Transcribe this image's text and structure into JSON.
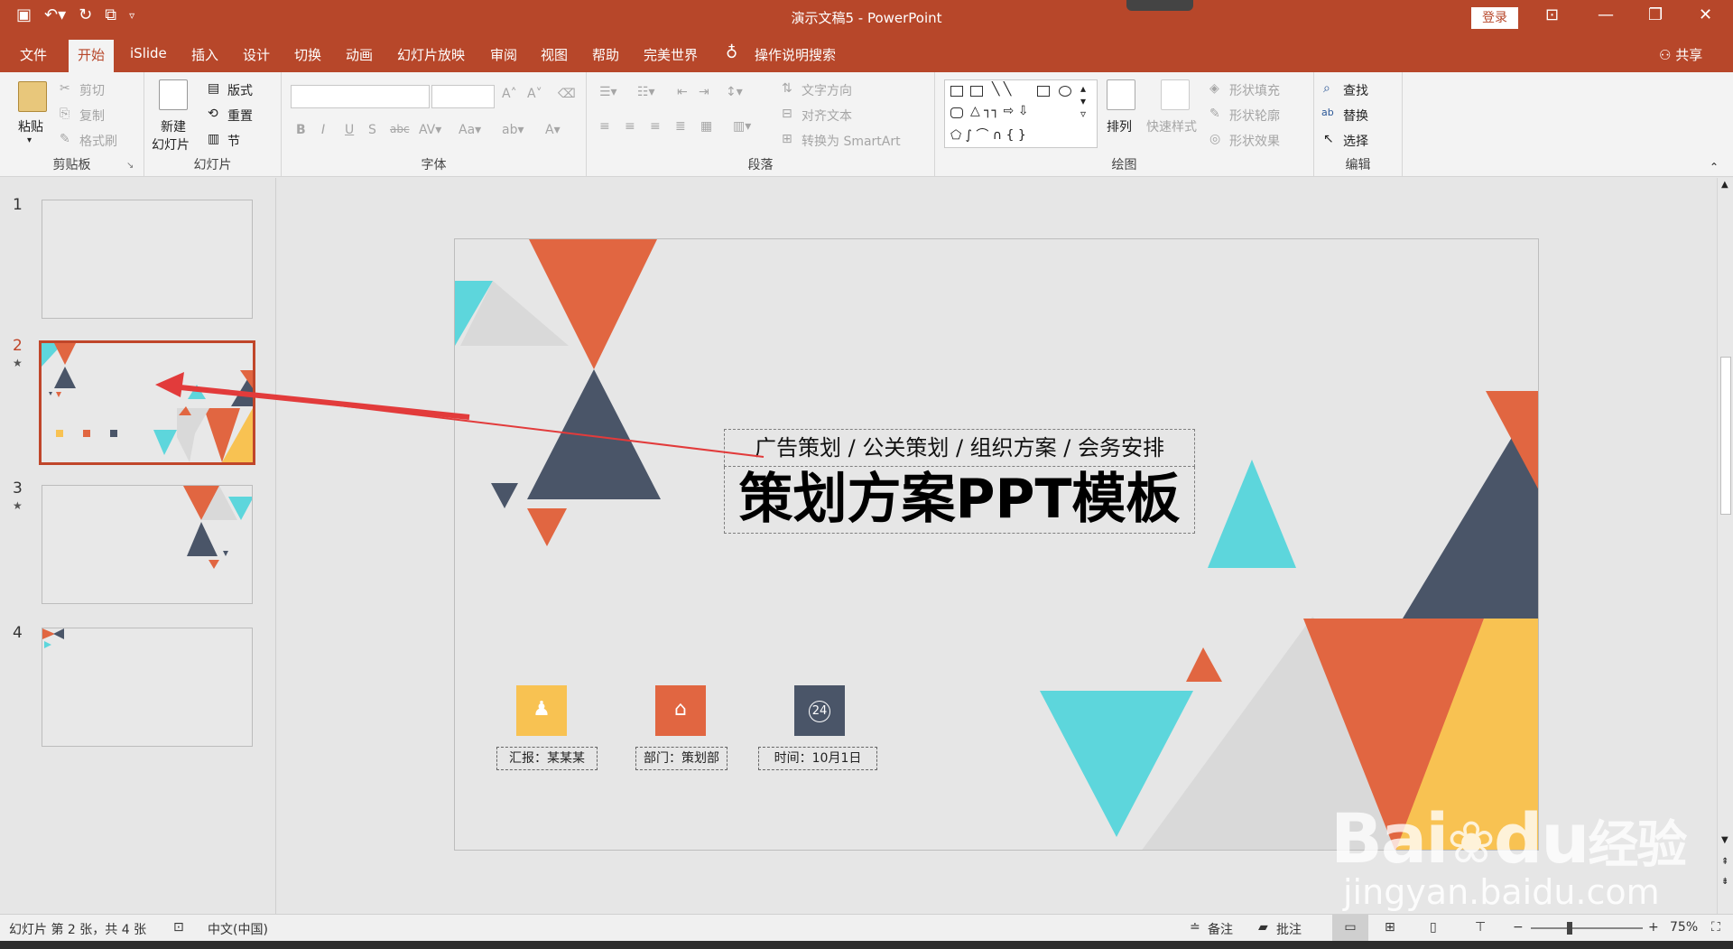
{
  "window": {
    "title": "演示文稿5 - PowerPoint",
    "login_label": "登录"
  },
  "tabs": {
    "items": [
      "文件",
      "开始",
      "iSlide",
      "插入",
      "设计",
      "切换",
      "动画",
      "幻灯片放映",
      "审阅",
      "视图",
      "帮助",
      "完美世界"
    ],
    "active": "开始",
    "tell_me": "操作说明搜索",
    "share": "共享"
  },
  "ribbon": {
    "clipboard": {
      "label": "剪贴板",
      "paste": "粘贴",
      "cut": "剪切",
      "copy": "复制",
      "format_painter": "格式刷"
    },
    "slides": {
      "label": "幻灯片",
      "new_slide_1": "新建",
      "new_slide_2": "幻灯片",
      "layout": "版式",
      "reset": "重置",
      "section": "节"
    },
    "font": {
      "label": "字体"
    },
    "paragraph": {
      "label": "段落",
      "text_direction": "文字方向",
      "align_text": "对齐文本",
      "smartart": "转换为 SmartArt"
    },
    "drawing": {
      "label": "绘图",
      "arrange": "排列",
      "quick_styles": "快速样式",
      "shape_fill": "形状填充",
      "shape_outline": "形状轮廓",
      "shape_effects": "形状效果"
    },
    "editing": {
      "label": "编辑",
      "find": "查找",
      "replace": "替换",
      "select": "选择"
    }
  },
  "thumbnails": [
    {
      "number": "1",
      "star": false
    },
    {
      "number": "2",
      "star": true,
      "selected": true
    },
    {
      "number": "3",
      "star": true
    },
    {
      "number": "4",
      "star": false
    }
  ],
  "slide": {
    "subtitle": "广告策划 / 公关策划 / 组织方案 / 会务安排",
    "title": "策划方案PPT模板",
    "info": [
      {
        "label": "汇报：某某某",
        "color": "#f8c252",
        "icon": "person-icon"
      },
      {
        "label": "部门：策划部",
        "color": "#e16641",
        "icon": "bank-icon"
      },
      {
        "label": "时间：10月1日",
        "color": "#4a5568",
        "icon": "clock-24-icon"
      }
    ],
    "thumb_info_text": "24"
  },
  "status": {
    "slide_info": "幻灯片 第 2 张，共 4 张",
    "language": "中文(中国)",
    "notes": "备注",
    "comments": "批注",
    "zoom": "75%"
  },
  "watermark": {
    "brand": "Bai",
    "brand2": "du",
    "product": "经验",
    "url": "jingyan.baidu.com"
  },
  "colors": {
    "accent": "#b7472a",
    "orange": "#e16641",
    "navy": "#4a5568",
    "cyan": "#5dd6dc",
    "yellow": "#f8c252",
    "lightgray": "#d9d9d9"
  }
}
